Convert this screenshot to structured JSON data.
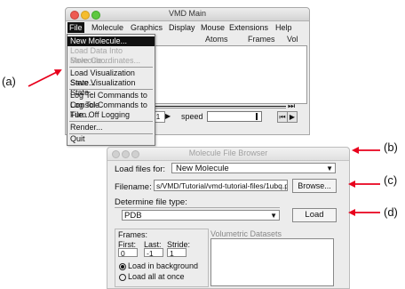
{
  "vmd_main": {
    "title": "VMD Main",
    "menus": [
      "File",
      "Molecule",
      "Graphics",
      "Display",
      "Mouse",
      "Extensions",
      "Help"
    ],
    "columns": [
      "Atoms",
      "Frames",
      "Vol"
    ],
    "step_label": "p",
    "step_value": "1",
    "speed_label": "speed"
  },
  "file_menu": {
    "items": [
      {
        "label": "New Molecule...",
        "state": "selected"
      },
      {
        "label": "Load Data Into Molecule...",
        "state": "disabled"
      },
      {
        "label": "Save Coordinates...",
        "state": "disabled"
      },
      {
        "label": "Load Visualization State...",
        "state": "normal"
      },
      {
        "label": "Save Visualization State...",
        "state": "normal"
      },
      {
        "label": "Log Tcl Commands to Console",
        "state": "normal"
      },
      {
        "label": "Log Tcl Commands to File...",
        "state": "normal"
      },
      {
        "label": "Turn Off Logging",
        "state": "normal"
      },
      {
        "label": "Render...",
        "state": "normal"
      },
      {
        "label": "Quit",
        "state": "normal"
      }
    ]
  },
  "file_browser": {
    "title": "Molecule File Browser",
    "load_for_label": "Load files for:",
    "load_for_value": "New Molecule",
    "filename_label": "Filename:",
    "filename_value": "s/VMD/Tutorial/vmd-tutorial-files/1ubq.pdb",
    "browse_label": "Browse...",
    "filetype_label": "Determine file type:",
    "filetype_value": "PDB",
    "load_label": "Load",
    "frames": {
      "title": "Frames:",
      "first_label": "First:",
      "last_label": "Last:",
      "stride_label": "Stride:",
      "first_value": "0",
      "last_value": "-1",
      "stride_value": "1",
      "radio_background": "Load in background",
      "radio_all": "Load all at once"
    },
    "volumetric_label": "Volumetric Datasets"
  },
  "annotations": {
    "a": "(a)",
    "b": "(b)",
    "c": "(c)",
    "d": "(d)"
  },
  "colors": {
    "arrow": "#e8001c",
    "selected_bg": "#111111"
  }
}
